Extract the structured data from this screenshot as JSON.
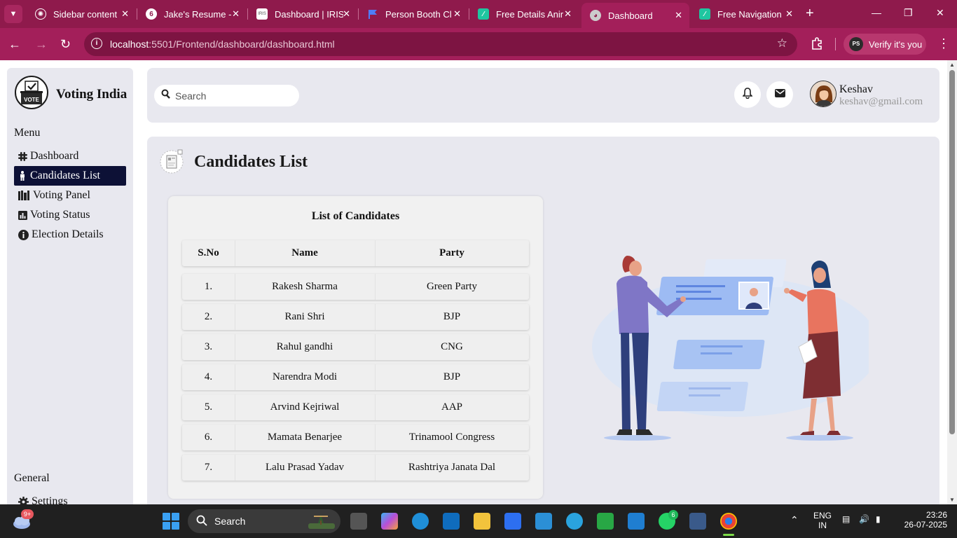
{
  "browser": {
    "tabs": [
      {
        "label": "Sidebar content",
        "color": "#ffffff",
        "icon": "openai-icon"
      },
      {
        "label": "Jake's Resume -",
        "color": "#ffffff",
        "icon": "overleaf-icon"
      },
      {
        "label": "Dashboard | IRIS",
        "color": "#ffffff",
        "icon": "iris-icon"
      },
      {
        "label": "Person Booth Cl",
        "color": "#4f7cf7",
        "icon": "flag-icon"
      },
      {
        "label": "Free Details Anir",
        "color": "#1fc6a0",
        "icon": "lottie-icon"
      },
      {
        "label": "Dashboard",
        "color": "#cccccc",
        "icon": "globe-icon"
      },
      {
        "label": "Free Navigation",
        "color": "#1fc6a0",
        "icon": "lottie-icon"
      }
    ],
    "url_host": "localhost",
    "url_path": ":5501/Frontend/dashboard/dashboard.html",
    "verify_label": "Verify it's you",
    "profile_initials": "PS"
  },
  "sidebar": {
    "brand": "Voting India",
    "logo_text": "VOTE",
    "menu_title": "Menu",
    "items": [
      {
        "label": "Dashboard",
        "icon": "slack-icon"
      },
      {
        "label": "Candidates List",
        "icon": "person-icon"
      },
      {
        "label": "Voting Panel",
        "icon": "booth-icon"
      },
      {
        "label": "Voting Status",
        "icon": "chart-icon"
      },
      {
        "label": "Election Details",
        "icon": "info-icon"
      }
    ],
    "general_title": "General",
    "settings_label": "Settings"
  },
  "topbar": {
    "search_placeholder": "Search",
    "user_name": "Keshav",
    "user_email": "keshav@gmail.com"
  },
  "content": {
    "title": "Candidates List",
    "card_title": "List of Candidates",
    "headers": [
      "S.No",
      "Name",
      "Party"
    ],
    "rows": [
      [
        "1.",
        "Rakesh Sharma",
        "Green Party"
      ],
      [
        "2.",
        "Rani Shri",
        "BJP"
      ],
      [
        "3.",
        "Rahul gandhi",
        "CNG"
      ],
      [
        "4.",
        "Narendra Modi",
        "BJP"
      ],
      [
        "5.",
        "Arvind Kejriwal",
        "AAP"
      ],
      [
        "6.",
        "Mamata Benarjee",
        "Trinamool Congress"
      ],
      [
        "7.",
        "Lalu Prasad Yadav",
        "Rashtriya Janata Dal"
      ]
    ]
  },
  "taskbar": {
    "weather_badge": "9+",
    "search_label": "Search",
    "whatsapp_badge": "6",
    "lang": "ENG",
    "region": "IN",
    "time": "23:26",
    "date": "26-07-2025"
  },
  "colors": {
    "frame": "#8f1a4c",
    "active_menu": "#0d1136",
    "panel": "#e8e8ef"
  }
}
